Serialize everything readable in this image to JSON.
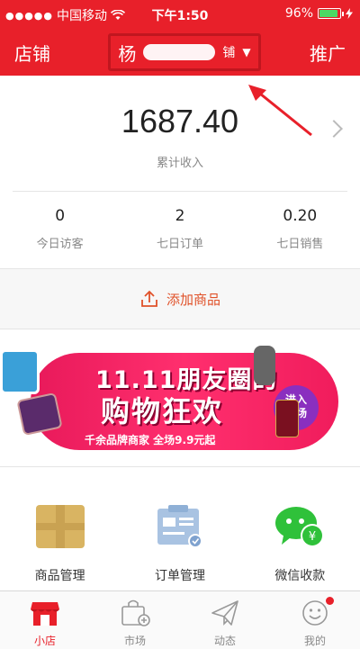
{
  "status_bar": {
    "carrier": "中国移动",
    "time": "下午1:50",
    "battery_percent": "96%",
    "battery_level": 0.96,
    "signal_dots": "●●●●●"
  },
  "nav": {
    "left_label": "店铺",
    "shop_name_visible": "杨",
    "shop_name_suffix_visible": "铺",
    "right_label": "推广"
  },
  "income": {
    "value": "1687.40",
    "label": "累计收入"
  },
  "stats": [
    {
      "value": "0",
      "label": "今日访客"
    },
    {
      "value": "2",
      "label": "七日订单"
    },
    {
      "value": "0.20",
      "label": "七日销售"
    }
  ],
  "add_product": {
    "label": "添加商品"
  },
  "banner": {
    "line1": "11.11朋友圈的",
    "line2": "购物狂欢",
    "line3": "千余品牌商家 全场9.9元起",
    "enter_line1": "进入",
    "enter_line2": "会场"
  },
  "tools": [
    {
      "label": "商品管理",
      "icon": "goods-box-icon"
    },
    {
      "label": "订单管理",
      "icon": "order-list-icon"
    },
    {
      "label": "微信收款",
      "icon": "wechat-pay-icon"
    }
  ],
  "tabbar": [
    {
      "label": "小店",
      "icon": "shop-icon",
      "active": true
    },
    {
      "label": "市场",
      "icon": "market-bag-icon",
      "active": false
    },
    {
      "label": "动态",
      "icon": "paper-plane-icon",
      "active": false
    },
    {
      "label": "我的",
      "icon": "smiley-icon",
      "active": false,
      "badge": true
    }
  ],
  "colors": {
    "brand_red": "#e8202a",
    "accent_orange": "#e0522a",
    "banner_pink": "#ff2f6e",
    "battery_green": "#4cd964"
  }
}
